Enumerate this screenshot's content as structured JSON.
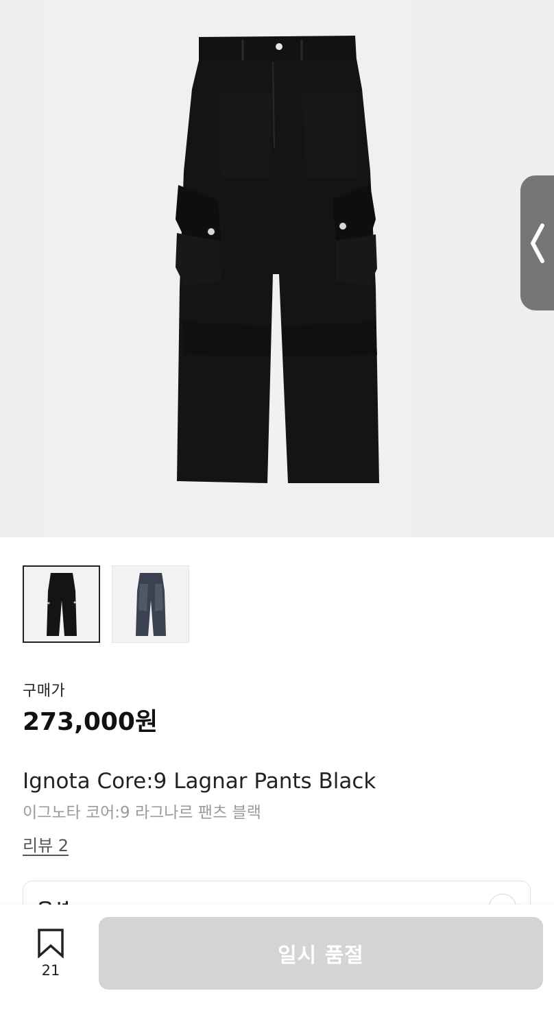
{
  "product": {
    "image_alt": "product-main-image",
    "thumbnails": [
      {
        "name": "black",
        "color": "#141414"
      },
      {
        "name": "washed-grey",
        "color": "#3a4150"
      }
    ],
    "price_label": "구매가",
    "price": "273,000원",
    "name_en": "Ignota Core:9 Lagnar Pants Black",
    "name_ko": "이그노타 코어:9 라그나르 팬츠 블랙",
    "review_link": "리뷰 2"
  },
  "options": {
    "label": "옵션"
  },
  "bottom_bar": {
    "bookmark_count": "21",
    "soldout_label": "일시 품절"
  },
  "colors": {
    "hero_bg": "#efefef",
    "side_tab": "#767676",
    "soldout_button": "#d4d4d4",
    "price_text": "#111111",
    "subtitle_text": "#9a9a9a"
  },
  "icons": {
    "side_tab": "chevron-left-icon",
    "bookmark": "bookmark-icon",
    "option": "chevron-down-icon"
  }
}
